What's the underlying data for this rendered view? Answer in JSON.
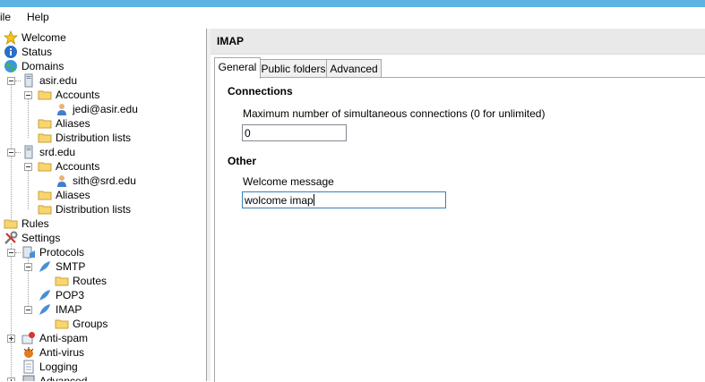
{
  "menu": {
    "file": "ile",
    "help": "Help"
  },
  "tree": {
    "welcome": "Welcome",
    "status": "Status",
    "domains": "Domains",
    "domain1": {
      "name": "asir.edu",
      "accounts": "Accounts",
      "account": "jedi@asir.edu",
      "aliases": "Aliases",
      "distribution": "Distribution lists"
    },
    "domain2": {
      "name": "srd.edu",
      "accounts": "Accounts",
      "account": "sith@srd.edu",
      "aliases": "Aliases",
      "distribution": "Distribution lists"
    },
    "rules": "Rules",
    "settings": "Settings",
    "protocols": "Protocols",
    "smtp": "SMTP",
    "routes": "Routes",
    "pop3": "POP3",
    "imap": "IMAP",
    "groups": "Groups",
    "antispam": "Anti-spam",
    "antivirus": "Anti-virus",
    "logging": "Logging",
    "advanced": "Advanced"
  },
  "panel": {
    "title": "IMAP",
    "tabs": [
      "General",
      "Public folders",
      "Advanced"
    ],
    "connections": {
      "heading": "Connections",
      "label": "Maximum number of simultaneous connections (0 for unlimited)",
      "value": "0"
    },
    "other": {
      "heading": "Other",
      "label": "Welcome message",
      "value": "wolcome imap"
    }
  },
  "colors": {
    "titlebar": "#5db4e3",
    "header": "#e9e9e9",
    "focus_border": "#3c7fb1"
  }
}
